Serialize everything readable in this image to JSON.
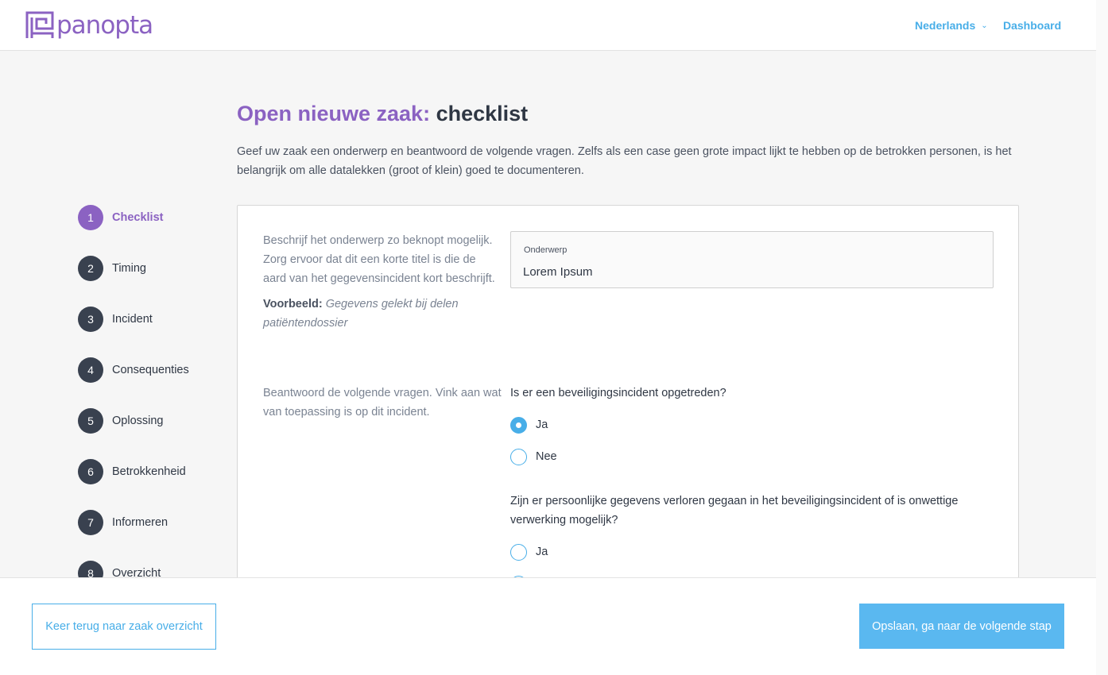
{
  "header": {
    "logo_text": "panopta",
    "language": "Nederlands",
    "dashboard": "Dashboard"
  },
  "page": {
    "title_accent": "Open nieuwe zaak:",
    "title_rest": "checklist",
    "intro": "Geef uw zaak een onderwerp en beantwoord de volgende vragen. Zelfs als een case geen grote impact lijkt te hebben op de betrokken personen, is het belangrijk om alle datalekken (groot of klein) goed te documenteren."
  },
  "steps": [
    {
      "num": "1",
      "label": "Checklist",
      "active": true
    },
    {
      "num": "2",
      "label": "Timing"
    },
    {
      "num": "3",
      "label": "Incident"
    },
    {
      "num": "4",
      "label": "Consequenties"
    },
    {
      "num": "5",
      "label": "Oplossing"
    },
    {
      "num": "6",
      "label": "Betrokkenheid"
    },
    {
      "num": "7",
      "label": "Informeren"
    },
    {
      "num": "8",
      "label": "Overzicht"
    }
  ],
  "form": {
    "subject_help": "Beschrijf het onderwerp zo beknopt mogelijk. Zorg ervoor dat dit een korte titel is die de aard van het gegevensincident kort beschrijft.",
    "example_label": "Voorbeeld:",
    "example_text": "Gegevens gelekt bij delen patiëntendossier",
    "subject_label": "Onderwerp",
    "subject_value": "Lorem Ipsum",
    "questions_help": "Beantwoord de volgende vragen. Vink aan wat van toepassing is op dit incident.",
    "q1": "Is er een beveiligingsincident opgetreden?",
    "q1_yes": "Ja",
    "q1_no": "Nee",
    "q1_selected": "Ja",
    "q2": "Zijn er persoonlijke gegevens verloren gegaan in het beveiligingsincident of is onwettige verwerking mogelijk?",
    "q2_yes": "Ja"
  },
  "footer": {
    "back_label": "Keer terug naar zaak overzicht",
    "next_label": "Opslaan, ga naar de volgende stap"
  },
  "colors": {
    "brand_purple": "#8b62c2",
    "accent_blue": "#48aee8",
    "step_dark": "#39414f"
  }
}
